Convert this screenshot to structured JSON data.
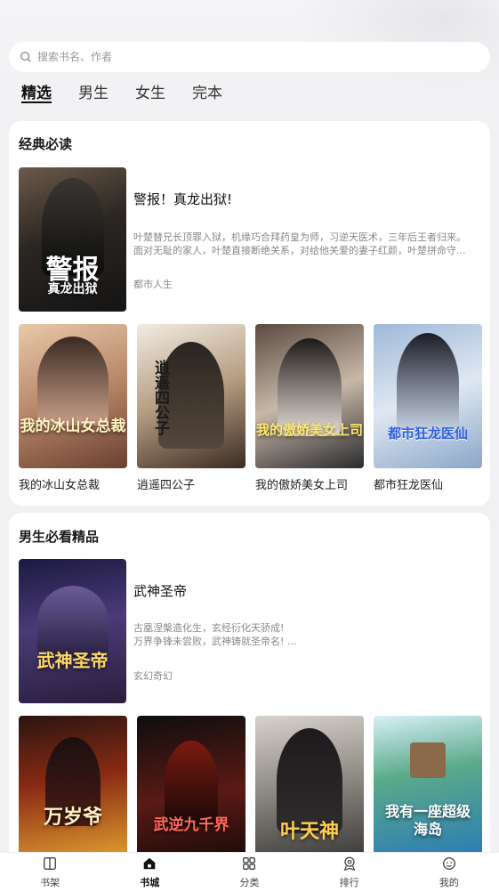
{
  "search": {
    "placeholder": "搜索书名、作者"
  },
  "tabs": [
    {
      "label": "精选",
      "active": true
    },
    {
      "label": "男生",
      "active": false
    },
    {
      "label": "女生",
      "active": false
    },
    {
      "label": "完本",
      "active": false
    }
  ],
  "sections": [
    {
      "title": "经典必读",
      "featured": {
        "title": "警报！真龙出狱!",
        "desc_line1": "叶楚替兄长顶罪入狱，机缘巧合拜药皇为师，习逆天医术，三年后王者归来。",
        "desc_line2": "面对无耻的家人，叶楚直接断绝关系，对给他关爱的妻子红颜，叶楚拼命守...",
        "category": "都市人生",
        "cover_text_main": "警报",
        "cover_text_sub": "真龙出狱"
      },
      "books": [
        {
          "name": "我的冰山女总裁",
          "cover_text": "我的冰山女总裁"
        },
        {
          "name": "逍遥四公子",
          "cover_text": "逍遥四公子"
        },
        {
          "name": "我的傲娇美女上司",
          "cover_text": "我的傲娇美女上司"
        },
        {
          "name": "都市狂龙医仙",
          "cover_text": "都市狂龙医仙"
        }
      ]
    },
    {
      "title": "男生必看精品",
      "featured": {
        "title": "武神圣帝",
        "desc_line1": "古凰涅槃造化生，玄经衍化天骄成!",
        "desc_line2": "万界争锋未尝败，武神铸就圣帝名! ...",
        "category": "玄幻奇幻",
        "cover_text_main": "武神圣帝",
        "cover_text_sub": ""
      },
      "books": [
        {
          "name": "",
          "cover_text": "万岁爷"
        },
        {
          "name": "",
          "cover_text": "武逆九千界"
        },
        {
          "name": "",
          "cover_text": "叶天神"
        },
        {
          "name": "",
          "cover_text": "我有一座超级海岛"
        }
      ]
    }
  ],
  "bottom_nav": [
    {
      "label": "书架",
      "icon": "bookshelf-icon",
      "active": false
    },
    {
      "label": "书城",
      "icon": "bookstore-icon",
      "active": true
    },
    {
      "label": "分类",
      "icon": "category-icon",
      "active": false
    },
    {
      "label": "排行",
      "icon": "ranking-icon",
      "active": false
    },
    {
      "label": "我的",
      "icon": "profile-icon",
      "active": false
    }
  ]
}
